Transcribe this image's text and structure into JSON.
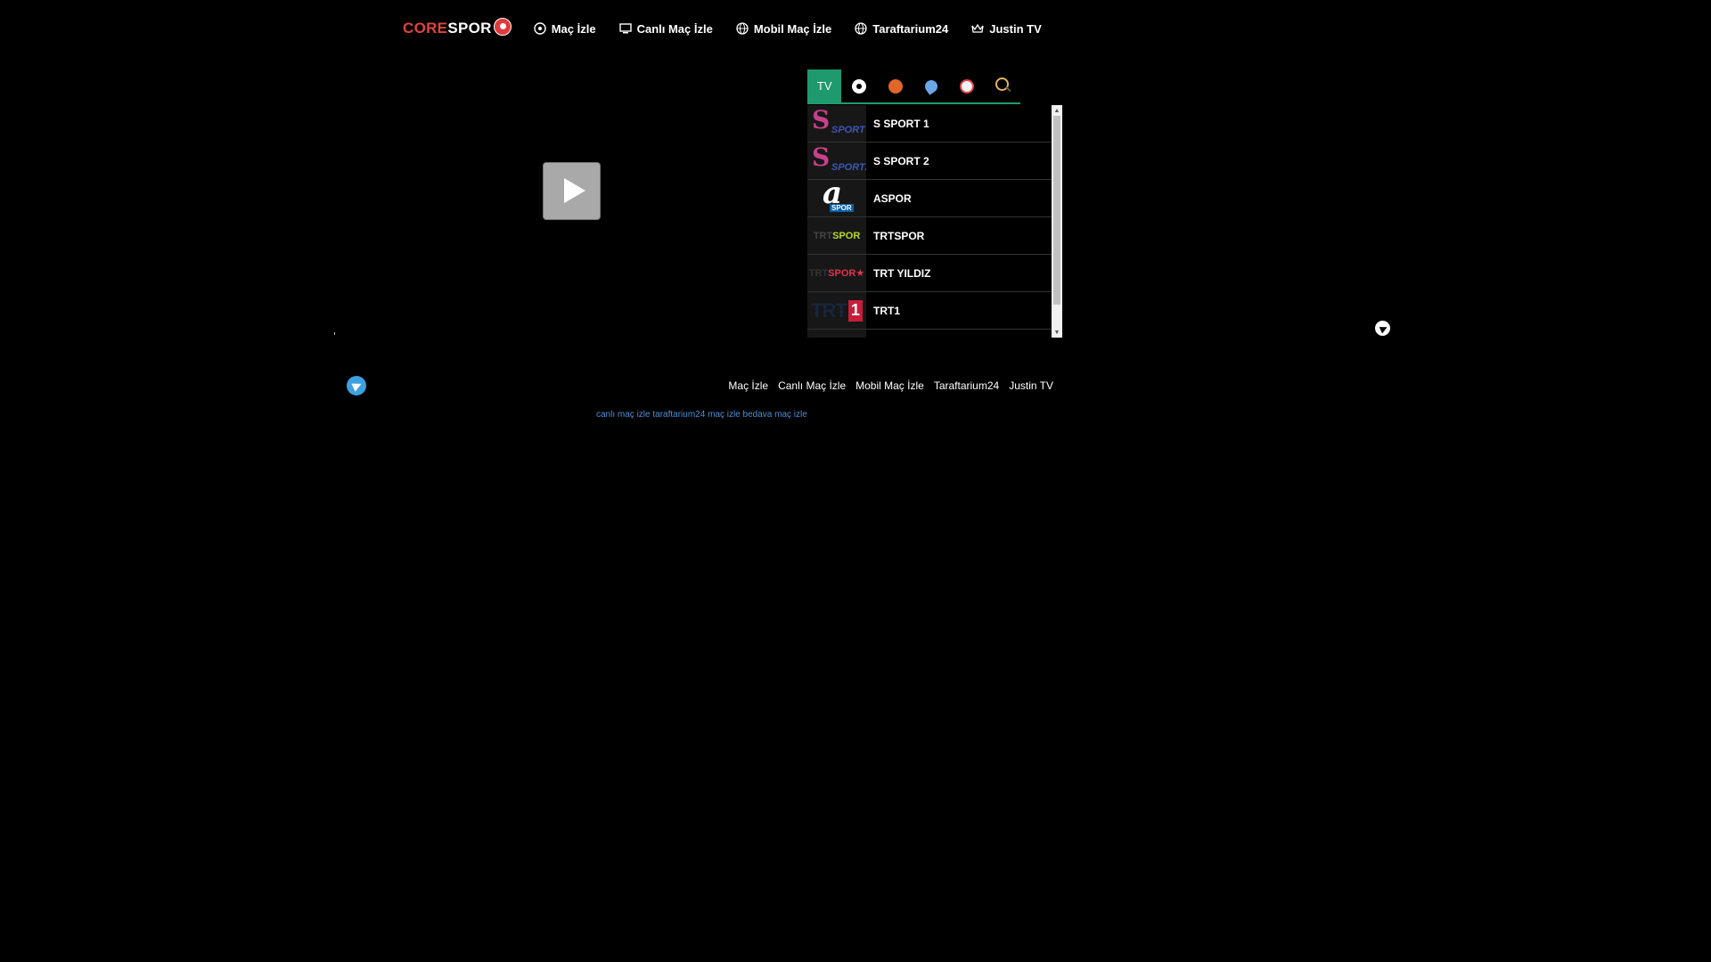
{
  "brand": {
    "part1": "CORE",
    "part2": "SPOR"
  },
  "nav": [
    {
      "label": "Maç İzle",
      "icon": "football-icon"
    },
    {
      "label": "Canlı Maç İzle",
      "icon": "tv-screen-icon"
    },
    {
      "label": "Mobil Maç İzle",
      "icon": "globe-icon"
    },
    {
      "label": "Taraftarium24",
      "icon": "globe-icon"
    },
    {
      "label": "Justin TV",
      "icon": "crown-icon"
    }
  ],
  "player": {
    "state": "paused",
    "control_icon": "play-icon"
  },
  "tabs": [
    {
      "label": "TV",
      "icon": "",
      "active": true
    },
    {
      "label": "",
      "icon": "football-icon"
    },
    {
      "label": "",
      "icon": "basketball-icon"
    },
    {
      "label": "",
      "icon": "tennis-icon"
    },
    {
      "label": "",
      "icon": "baseball-icon"
    },
    {
      "label": "",
      "icon": "search-icon"
    }
  ],
  "channels": [
    {
      "name": "S SPORT 1",
      "logo": {
        "a": "S",
        "b": "SPORT"
      }
    },
    {
      "name": "S SPORT 2",
      "logo": {
        "a": "S",
        "b": "SPORT2"
      }
    },
    {
      "name": "ASPOR",
      "logo": {
        "a": "a",
        "b": "SPOR"
      }
    },
    {
      "name": "TRTSPOR",
      "logo": {
        "a": "TRT",
        "b": "SPOR"
      }
    },
    {
      "name": "TRT YILDIZ",
      "logo": {
        "a": "TRT",
        "b": "SPOR★"
      }
    },
    {
      "name": "TRT1",
      "logo": {
        "a": "TRT",
        "b": "1"
      }
    }
  ],
  "footer": {
    "links": [
      "Maç İzle",
      "Canlı Maç İzle",
      "Mobil Maç İzle",
      "Taraftarium24",
      "Justin TV"
    ],
    "tags": [
      "canlı maç izle",
      "taraftarium24",
      "maç izle",
      "bedava maç izle"
    ]
  },
  "colors": {
    "accent": "#1f9a6e",
    "brand_red": "#e0443a",
    "link_blue": "#4d8fd6",
    "telegram": "#3ea0e0"
  }
}
